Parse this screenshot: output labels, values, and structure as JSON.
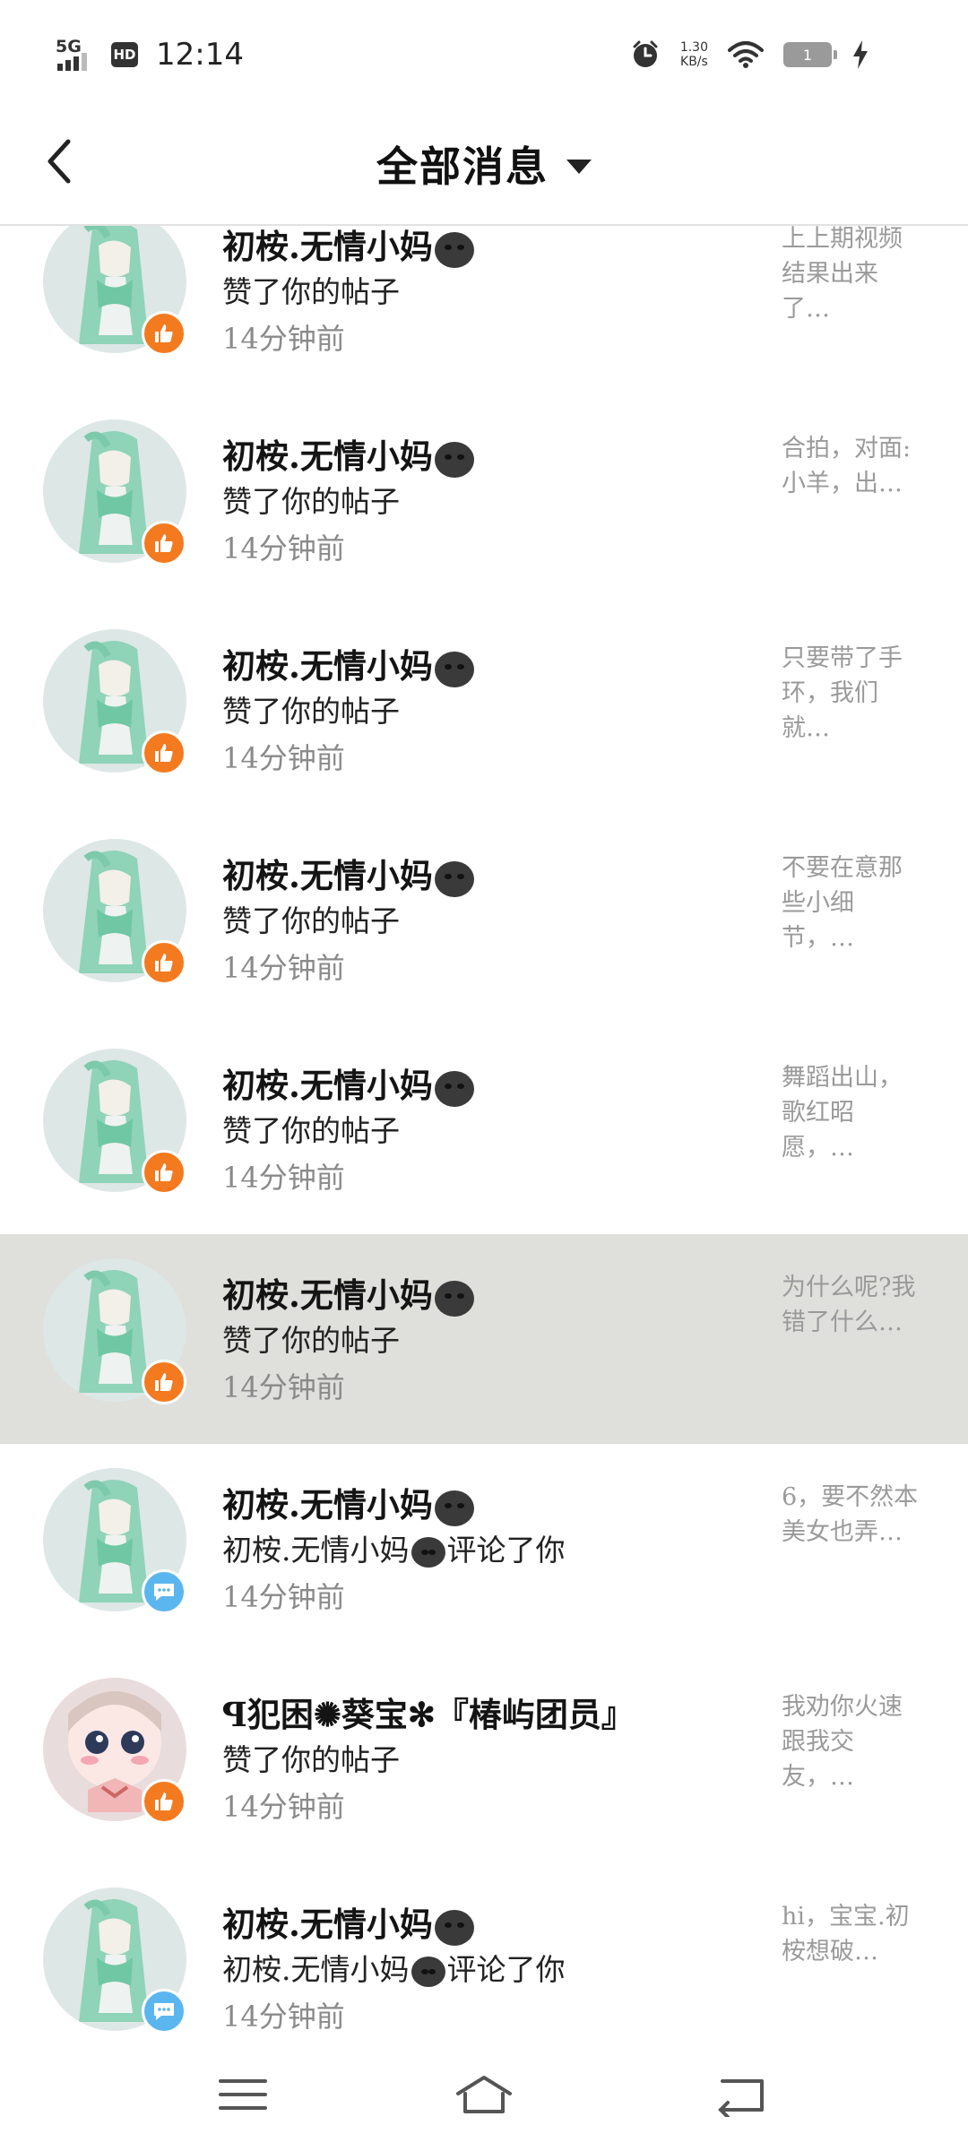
{
  "status_bar": {
    "network": "5G",
    "hd": "HD",
    "time": "12:14",
    "speed_value": "1.30",
    "speed_unit": "KB/s",
    "battery": "1"
  },
  "header": {
    "title": "全部消息"
  },
  "notifications": [
    {
      "name": "初桉.无情小妈",
      "action": "赞了你的帖子",
      "time": "14分钟前",
      "preview": "上上期视频结果出来了…",
      "type": "like",
      "avatar": "green"
    },
    {
      "name": "初桉.无情小妈",
      "action": "赞了你的帖子",
      "time": "14分钟前",
      "preview": "合拍，对面:小羊，出…",
      "type": "like",
      "avatar": "green"
    },
    {
      "name": "初桉.无情小妈",
      "action": "赞了你的帖子",
      "time": "14分钟前",
      "preview": "只要带了手环，我们就…",
      "type": "like",
      "avatar": "green"
    },
    {
      "name": "初桉.无情小妈",
      "action": "赞了你的帖子",
      "time": "14分钟前",
      "preview": "不要在意那些小细节，…",
      "type": "like",
      "avatar": "green"
    },
    {
      "name": "初桉.无情小妈",
      "action": "赞了你的帖子",
      "time": "14分钟前",
      "preview": "舞蹈出山，歌红昭愿，…",
      "type": "like",
      "avatar": "green"
    },
    {
      "name": "初桉.无情小妈",
      "action": "赞了你的帖子",
      "time": "14分钟前",
      "preview": "为什么呢?我错了什么…",
      "type": "like",
      "avatar": "green",
      "selected": true
    },
    {
      "name": "初桉.无情小妈",
      "action_prefix": "初桉.无情小妈",
      "action_suffix": "评论了你",
      "time": "14分钟前",
      "preview": "6，要不然本美女也弄…",
      "type": "comment",
      "avatar": "green"
    },
    {
      "name": "ꟼ犯困✺葵宝✻『椿屿团员』",
      "action": "赞了你的帖子",
      "time": "14分钟前",
      "preview": "我劝你火速跟我交友，…",
      "type": "like",
      "avatar": "pink"
    },
    {
      "name": "初桉.无情小妈",
      "action_prefix": "初桉.无情小妈",
      "action_suffix": "评论了你",
      "time": "14分钟前",
      "preview": "hi，宝宝.初桉想破…",
      "type": "comment",
      "avatar": "green"
    }
  ],
  "navigation": {
    "menu": "menu-icon",
    "home": "home-icon",
    "back": "back-icon"
  }
}
